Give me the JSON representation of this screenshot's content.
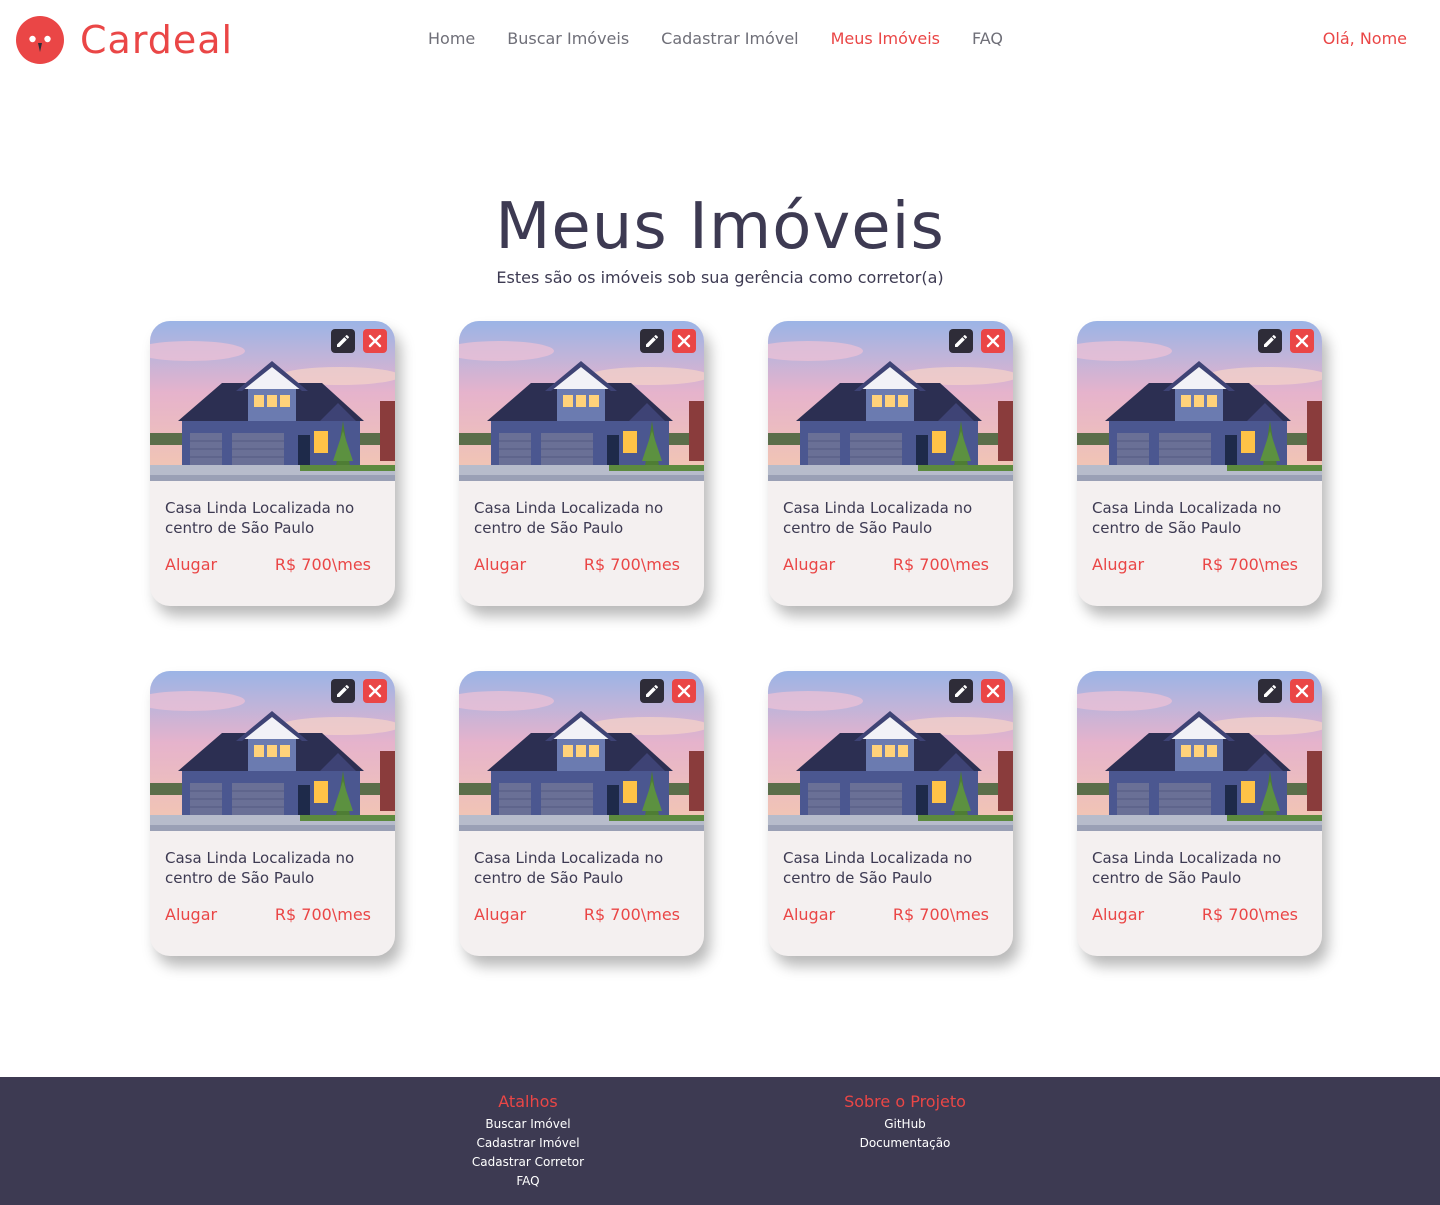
{
  "brand": {
    "name": "Cardeal",
    "accent_color": "#ea4646",
    "dark_color": "#3d3a52"
  },
  "nav": {
    "items": [
      "Home",
      "Buscar Imóveis",
      "Cadastrar Imóvel",
      "Meus Imóveis",
      "FAQ"
    ],
    "active": "Meus Imóveis"
  },
  "user": {
    "greeting": "Olá, Nome"
  },
  "page": {
    "title": "Meus Imóveis",
    "subtitle": "Estes são os imóveis sob sua gerência como corretor(a)"
  },
  "properties": [
    {
      "title": "Casa Linda Localizada  no centro de São Paulo",
      "type": "Alugar",
      "price": "R$ 700\\mes"
    },
    {
      "title": "Casa Linda Localizada  no centro de São Paulo",
      "type": "Alugar",
      "price": "R$ 700\\mes"
    },
    {
      "title": "Casa Linda Localizada  no centro de São Paulo",
      "type": "Alugar",
      "price": "R$ 700\\mes"
    },
    {
      "title": "Casa Linda Localizada  no centro de São Paulo",
      "type": "Alugar",
      "price": "R$ 700\\mes"
    },
    {
      "title": "Casa Linda Localizada  no centro de São Paulo",
      "type": "Alugar",
      "price": "R$ 700\\mes"
    },
    {
      "title": "Casa Linda Localizada  no centro de São Paulo",
      "type": "Alugar",
      "price": "R$ 700\\mes"
    },
    {
      "title": "Casa Linda Localizada  no centro de São Paulo",
      "type": "Alugar",
      "price": "R$ 700\\mes"
    },
    {
      "title": "Casa Linda Localizada  no centro de São Paulo",
      "type": "Alugar",
      "price": "R$ 700\\mes"
    }
  ],
  "card_icons": {
    "edit": "pencil-icon",
    "delete": "close-icon"
  },
  "footer": {
    "shortcuts": {
      "heading": "Atalhos",
      "links": [
        "Buscar Imóvel",
        "Cadastrar Imóvel",
        "Cadastrar Corretor",
        "FAQ"
      ]
    },
    "about": {
      "heading": "Sobre o Projeto",
      "links": [
        "GitHub",
        "Documentação"
      ]
    }
  }
}
